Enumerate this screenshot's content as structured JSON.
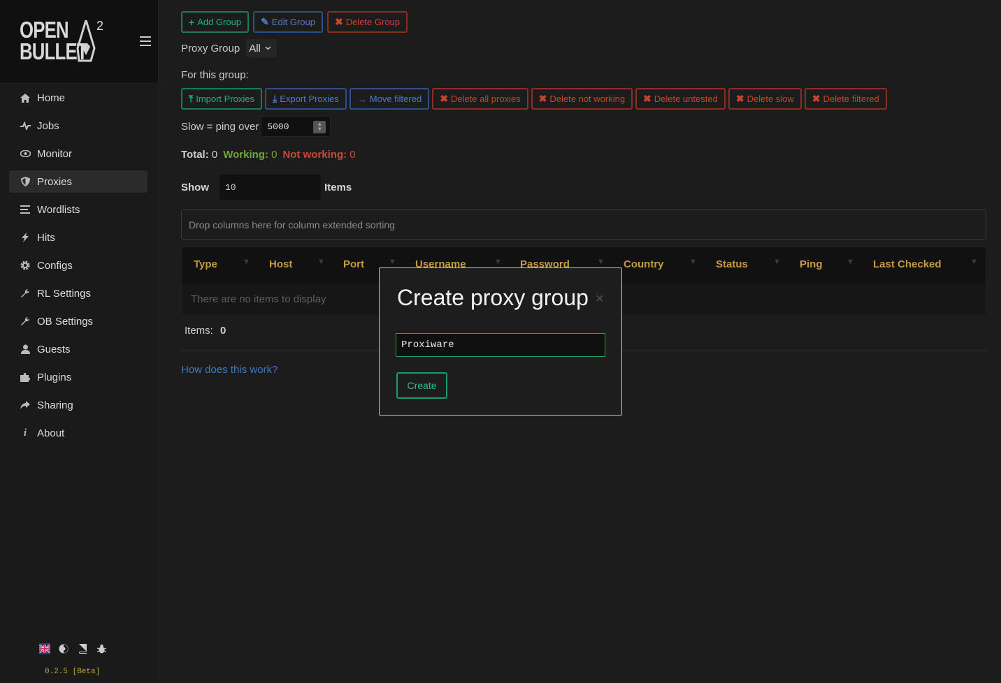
{
  "app": {
    "logo_line1": "OPEN",
    "logo_line2": "BULLET",
    "logo_sup": "2",
    "version": "0.2.5 [Beta]"
  },
  "sidebar": {
    "items": [
      {
        "label": "Home",
        "icon": "home-icon"
      },
      {
        "label": "Jobs",
        "icon": "pulse-icon"
      },
      {
        "label": "Monitor",
        "icon": "eye-icon"
      },
      {
        "label": "Proxies",
        "icon": "shield-icon",
        "active": true
      },
      {
        "label": "Wordlists",
        "icon": "list-icon"
      },
      {
        "label": "Hits",
        "icon": "bolt-icon"
      },
      {
        "label": "Configs",
        "icon": "gear-icon"
      },
      {
        "label": "RL Settings",
        "icon": "wrench-icon"
      },
      {
        "label": "OB Settings",
        "icon": "wrench-icon"
      },
      {
        "label": "Guests",
        "icon": "user-icon"
      },
      {
        "label": "Plugins",
        "icon": "puzzle-icon"
      },
      {
        "label": "Sharing",
        "icon": "share-icon"
      },
      {
        "label": "About",
        "icon": "info-icon"
      }
    ],
    "footer_icons": [
      "uk-flag-icon",
      "theme-icon",
      "book-icon",
      "bug-icon"
    ]
  },
  "toolbar": {
    "add_group": "Add Group",
    "edit_group": "Edit Group",
    "delete_group": "Delete Group"
  },
  "proxy_group": {
    "label": "Proxy Group",
    "selected": "All"
  },
  "for_group_label": "For this group:",
  "group_actions": {
    "import": "Import Proxies",
    "export": "Export Proxies",
    "move_filtered": "Move filtered",
    "delete_all": "Delete all proxies",
    "delete_not_working": "Delete not working",
    "delete_untested": "Delete untested",
    "delete_slow": "Delete slow",
    "delete_filtered": "Delete filtered"
  },
  "slow": {
    "label": "Slow = ping over",
    "value": "5000"
  },
  "totals": {
    "total_label": "Total:",
    "total_value": "0",
    "working_label": "Working:",
    "working_value": "0",
    "not_working_label": "Not working:",
    "not_working_value": "0"
  },
  "show": {
    "label": "Show",
    "value": "10",
    "suffix": "Items"
  },
  "grid": {
    "dropzone_text": "Drop columns here for column extended sorting",
    "columns": [
      "Type",
      "Host",
      "Port",
      "Username",
      "Password",
      "Country",
      "Status",
      "Ping",
      "Last Checked"
    ],
    "empty_text": "There are no items to display",
    "items_label": "Items:",
    "items_value": "0"
  },
  "help_link": "How does this work?",
  "modal": {
    "title": "Create proxy group",
    "close": "×",
    "input_value": "Proxiware",
    "create_button": "Create"
  },
  "colors": {
    "accent_green": "#27b07d",
    "accent_blue": "#4e7dc2",
    "accent_red": "#c9442f",
    "header_gold": "#c59a43"
  }
}
